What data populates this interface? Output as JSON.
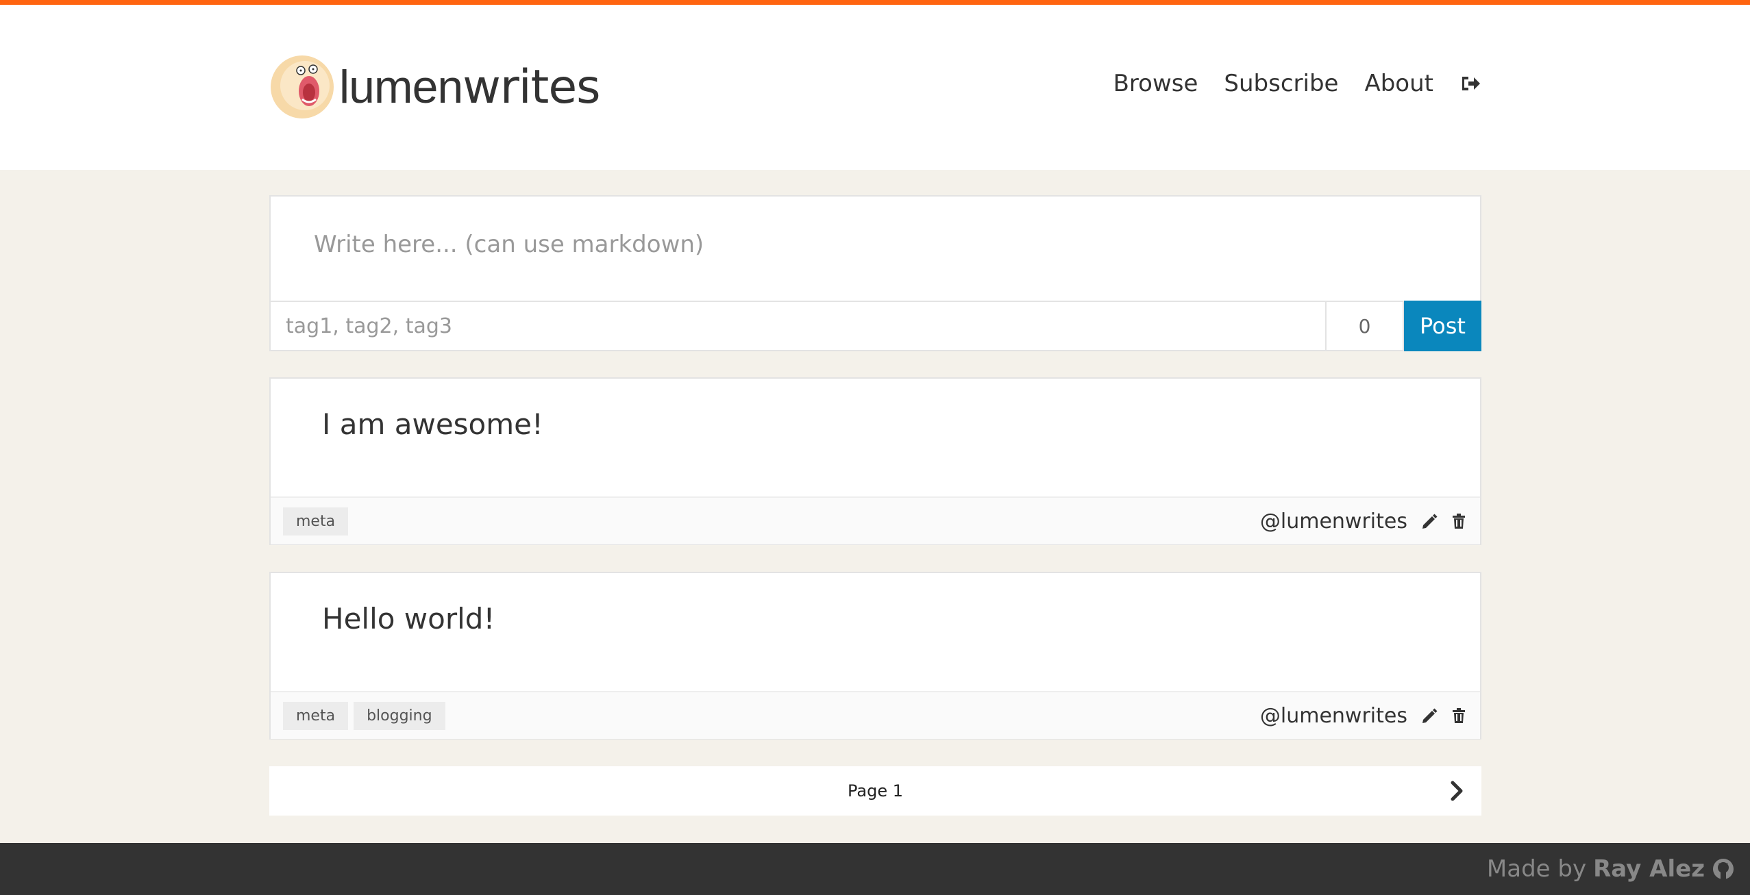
{
  "colors": {
    "accent_bar": "#ff6410",
    "post_button": "#0a87bd",
    "page_bg": "#f4f1ea",
    "footer_bg": "#333333"
  },
  "header": {
    "logo_light": "lumen",
    "logo_bold": "writes",
    "nav": {
      "browse": "Browse",
      "subscribe": "Subscribe",
      "about": "About",
      "logout_icon": "sign-out-icon"
    }
  },
  "composer": {
    "text_placeholder": "Write here... (can use markdown)",
    "tags_placeholder": "tag1, tag2, tag3",
    "char_count": "0",
    "post_label": "Post"
  },
  "posts": [
    {
      "text": "I am awesome!",
      "tags": [
        "meta"
      ],
      "author": "@lumenwrites"
    },
    {
      "text": "Hello world!",
      "tags": [
        "meta",
        "blogging"
      ],
      "author": "@lumenwrites"
    }
  ],
  "pager": {
    "label": "Page 1"
  },
  "footer": {
    "made_by": "Made by",
    "name": "Ray Alez"
  }
}
